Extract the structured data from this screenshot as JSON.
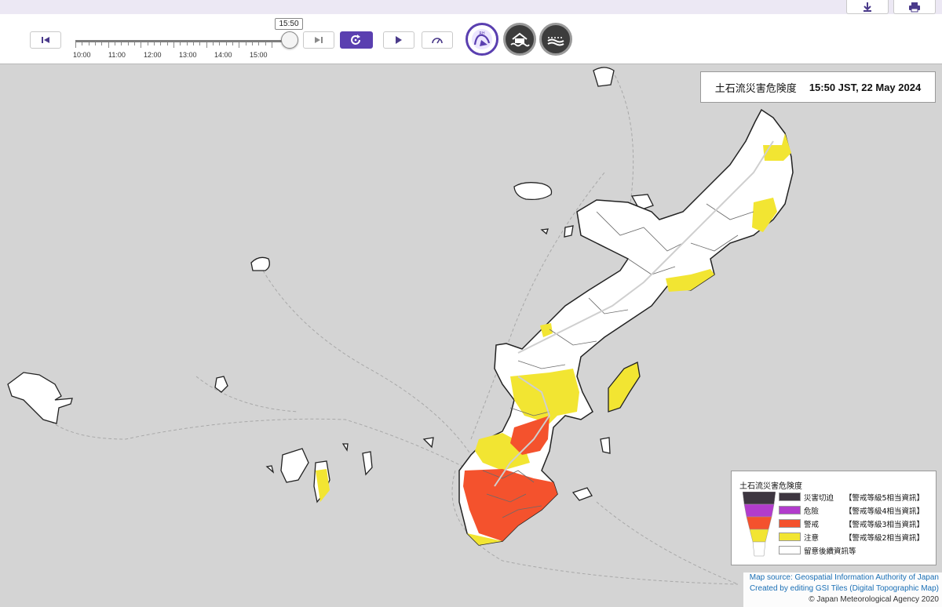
{
  "toolbar": {
    "current_time": "15:50",
    "timeline_ticks": [
      "10:00",
      "11:00",
      "12:00",
      "13:00",
      "14:00",
      "15:00"
    ],
    "timeline_progress": 1.0,
    "icons": {
      "first": "skip-to-start-icon",
      "last": "skip-to-end-icon",
      "refresh": "refresh-icon",
      "play": "play-icon",
      "speed": "speedometer-icon",
      "download": "download-icon",
      "print": "print-icon"
    },
    "layers": [
      {
        "name": "landslide-layer",
        "active": true
      },
      {
        "name": "inundation-layer",
        "active": false
      },
      {
        "name": "flood-layer",
        "active": false
      }
    ]
  },
  "title_box": {
    "title": "土石流災害危険度",
    "datetime": "15:50 JST, 22 May 2024"
  },
  "legend": {
    "title": "土石流災害危険度",
    "items": [
      {
        "name": "災害切迫",
        "info": "【警戒等級5相当資訊】",
        "color": "#3d3640"
      },
      {
        "name": "危險",
        "info": "【警戒等級4相当資訊】",
        "color": "#b23ccc"
      },
      {
        "name": "警戒",
        "info": "【警戒等級3相当資訊】",
        "color": "#f4522d"
      },
      {
        "name": "注意",
        "info": "【警戒等級2相当資訊】",
        "color": "#f2e532"
      },
      {
        "name": "",
        "info": "留意後續資訊等",
        "color": "#ffffff"
      }
    ]
  },
  "credits": {
    "line1": "Map source: Geospatial Information Authority of Japan",
    "line2": "Created by editing GSI Tiles (Digital Topographic Map)",
    "line3": "© Japan Meteorological Agency 2020"
  },
  "colors": {
    "sea": "#d4d4d4",
    "land": "#ffffff",
    "caution_yellow": "#f2e532",
    "warning_orange": "#f4522d",
    "accent": "#5a3fb0"
  }
}
